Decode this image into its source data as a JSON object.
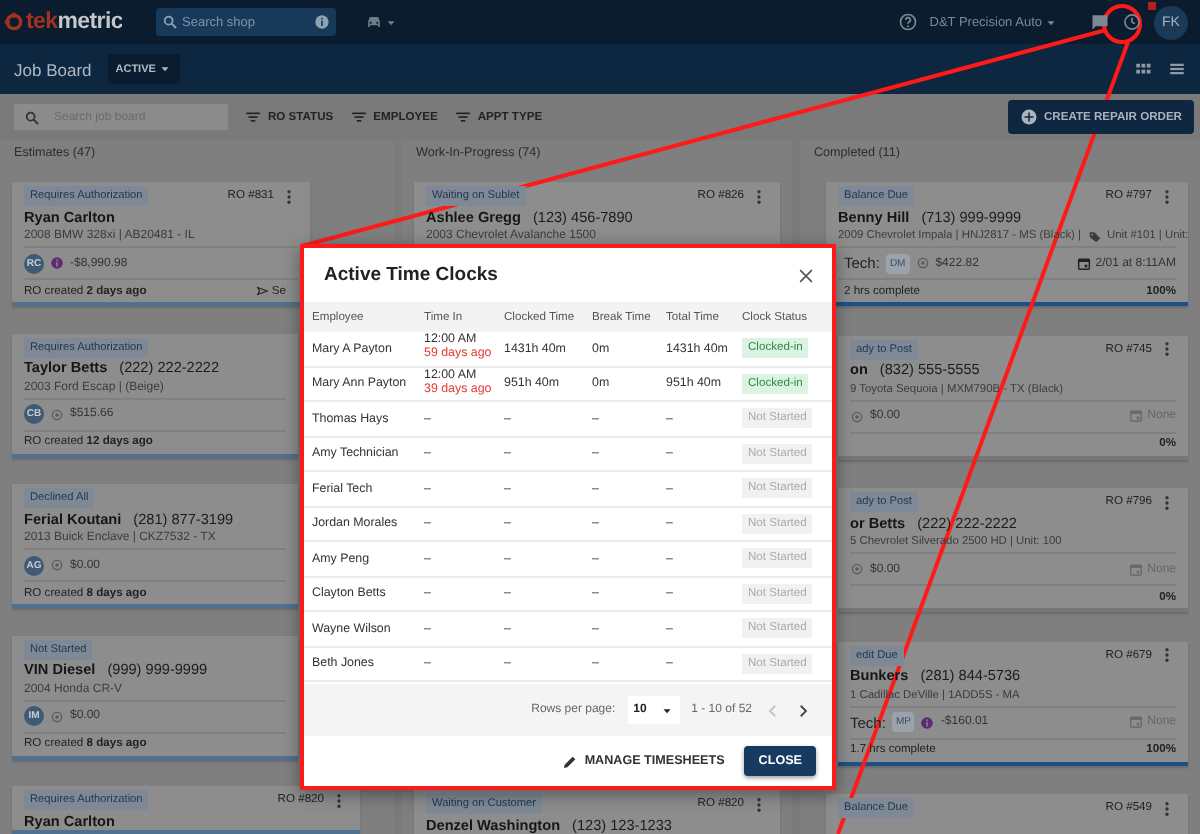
{
  "top_bar": {
    "logo": "tekmetric",
    "search": {
      "placeholder": "Search shop"
    },
    "shop": "D&T Precision Auto",
    "avatar": "FK",
    "notification_badge": true
  },
  "sub_bar": {
    "title": "Job Board",
    "filter": "ACTIVE"
  },
  "filter_bar": {
    "search": {
      "placeholder": "Search job board"
    },
    "filters": [
      "RO STATUS",
      "EMPLOYEE",
      "APPT TYPE"
    ],
    "create_button": "CREATE REPAIR ORDER"
  },
  "columns": [
    {
      "title": "Estimates (47)",
      "cards": [
        {
          "status": "Requires Authorization",
          "ro": "RO #831",
          "name": "Ryan Carlton",
          "vehicle": "2008 BMW 328xi | AB20481 - IL",
          "avatar": "RC",
          "flagged": true,
          "amount": "-$8,990.98",
          "created": "RO created **2 days ago**",
          "action": "Se"
        },
        {
          "status": "Requires Authorization",
          "name": "Taylor Betts",
          "phone": "(222) 222-2222",
          "vehicle": "2003 Ford Escap | (Beige)",
          "avatar": "CB",
          "flagged": false,
          "amount": "$515.66",
          "created": "RO created **12 days ago**"
        },
        {
          "status": "Declined All",
          "name": "Ferial Koutani",
          "phone": "(281) 877-3199",
          "vehicle": "2013 Buick Enclave | CKZ7532 - TX",
          "avatar": "AG",
          "flagged": false,
          "amount": "$0.00",
          "created": "RO created **8 days ago**"
        },
        {
          "status": "Not Started",
          "name": "VIN Diesel",
          "phone": "(999) 999-9999",
          "vehicle": "2004 Honda CR-V",
          "avatar": "IM",
          "flagged": false,
          "amount": "$0.00",
          "created": "RO created **8 days ago**"
        },
        {
          "status": "Requires Authorization",
          "ro": "RO #820",
          "name": "Ryan Carlton"
        }
      ]
    },
    {
      "title": "Work-In-Progress (74)",
      "cards": [
        {
          "status": "Waiting on Sublet",
          "ro": "RO #826",
          "name": "Ashlee Gregg",
          "phone": "(123) 456-7890",
          "vehicle": "2003 Chevrolet Avalanche 1500"
        },
        {
          "status": "Waiting on Customer",
          "ro": "RO #820",
          "name": "Denzel Washington",
          "phone": "(123) 123-1233"
        }
      ]
    },
    {
      "title": "Completed (11)",
      "cards": [
        {
          "status": "Balance Due",
          "ro": "RO #797",
          "name": "Benny Hill",
          "phone": "(713) 999-9999",
          "vehicle": "2009 Chevrolet Impala | HNJ2817 - MS (Black) |",
          "unit": "Unit #101 | Unit:",
          "tech_label": "Tech:",
          "avatar": "DM",
          "flagged": false,
          "amount": "$422.82",
          "date": "2/01 at 8:11AM",
          "scheduled": true,
          "hours": "2 hrs complete",
          "percent": "100%",
          "level": 1
        },
        {
          "status": "ady to Post",
          "ro": "RO #745",
          "name": "on",
          "phone": "(832) 555-5555",
          "vehicle": "9 Toyota Sequoia | MXM790B - TX (Black)",
          "flagged": false,
          "amount": "$0.00",
          "date": "None",
          "scheduled": false,
          "percent": "0%",
          "level": 0
        },
        {
          "status": "ady to Post",
          "ro": "RO #796",
          "name": "or Betts",
          "phone": "(222) 222-2222",
          "vehicle": "5 Chevrolet Silverado 2500 HD | Unit: 100",
          "flagged": false,
          "amount": "$0.00",
          "date": "None",
          "scheduled": false,
          "percent": "0%",
          "level": 0
        },
        {
          "status": "edit Due",
          "ro": "RO #679",
          "name": "Bunkers",
          "phone": "(281) 844-5736",
          "vehicle": "1 Cadillac DeVille | 1ADD5S - MA",
          "tech_label": "Tech:",
          "avatar": "MP",
          "flagged": true,
          "amount": "-$160.01",
          "date": "None",
          "scheduled": false,
          "hours": "1.7 hrs complete",
          "percent": "100%",
          "level": 1
        },
        {
          "status": "Balance Due",
          "ro": "RO #549"
        }
      ]
    }
  ],
  "time_clocks_dialog": {
    "title": "Active Time Clocks",
    "columns": [
      "Employee",
      "Time In",
      "Clocked Time",
      "Break Time",
      "Total Time",
      "Clock Status"
    ],
    "rows": [
      {
        "employee": "Mary A Payton",
        "time_in": "12:00 AM",
        "time_in_ago": "59 days ago",
        "clocked": "1431h 40m",
        "break": "0m",
        "total": "1431h 40m",
        "status": "Clocked-in",
        "kind": "clocked_in"
      },
      {
        "employee": "Mary Ann Payton",
        "time_in": "12:00 AM",
        "time_in_ago": "39 days ago",
        "clocked": "951h 40m",
        "break": "0m",
        "total": "951h 40m",
        "status": "Clocked-in",
        "kind": "clocked_in"
      },
      {
        "employee": "Thomas Hays",
        "time_in": "–",
        "clocked": "–",
        "break": "–",
        "total": "–",
        "status": "Not Started",
        "kind": "not_started"
      },
      {
        "employee": "Amy Technician",
        "time_in": "–",
        "clocked": "–",
        "break": "–",
        "total": "–",
        "status": "Not Started",
        "kind": "not_started"
      },
      {
        "employee": "Ferial Tech",
        "time_in": "–",
        "clocked": "–",
        "break": "–",
        "total": "–",
        "status": "Not Started",
        "kind": "not_started"
      },
      {
        "employee": "Jordan Morales",
        "time_in": "–",
        "clocked": "–",
        "break": "–",
        "total": "–",
        "status": "Not Started",
        "kind": "not_started"
      },
      {
        "employee": "Amy Peng",
        "time_in": "–",
        "clocked": "–",
        "break": "–",
        "total": "–",
        "status": "Not Started",
        "kind": "not_started"
      },
      {
        "employee": "Clayton Betts",
        "time_in": "–",
        "clocked": "–",
        "break": "–",
        "total": "–",
        "status": "Not Started",
        "kind": "not_started"
      },
      {
        "employee": "Wayne Wilson",
        "time_in": "–",
        "clocked": "–",
        "break": "–",
        "total": "–",
        "status": "Not Started",
        "kind": "not_started"
      },
      {
        "employee": "Beth Jones",
        "time_in": "–",
        "clocked": "–",
        "break": "–",
        "total": "–",
        "status": "Not Started",
        "kind": "not_started"
      }
    ],
    "rows_per_page_label": "Rows per page:",
    "rows_per_page": "10",
    "range": "1 - 10 of 52",
    "prev_disabled": true,
    "next_disabled": false,
    "manage_button": "MANAGE TIMESHEETS",
    "close_button": "CLOSE"
  }
}
